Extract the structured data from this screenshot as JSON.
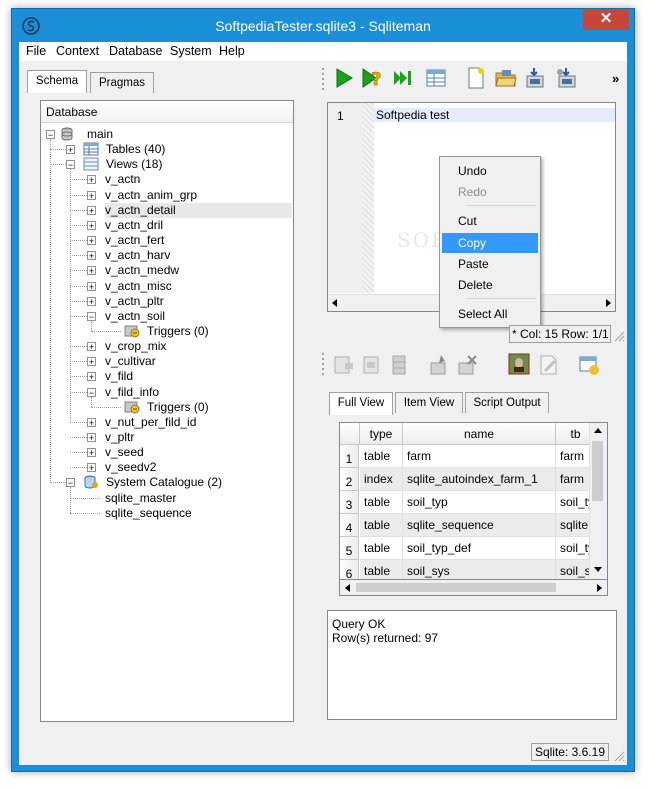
{
  "window": {
    "title": "SoftpediaTester.sqlite3 - Sqliteman",
    "close_glyph": "✕",
    "watermark": "SOFTPEDIA"
  },
  "menubar": {
    "items": [
      "File",
      "Context",
      "Database",
      "System",
      "Help"
    ]
  },
  "left_tabs": [
    "Schema",
    "Pragmas"
  ],
  "tree": {
    "header": "Database",
    "main_label": "main",
    "tables_label": "Tables (40)",
    "views_label": "Views (18)",
    "views": [
      "v_actn",
      "v_actn_anim_grp",
      "v_actn_detail",
      "v_actn_dril",
      "v_actn_fert",
      "v_actn_harv",
      "v_actn_medw",
      "v_actn_misc",
      "v_actn_pltr",
      "v_actn_soil",
      "v_crop_mix",
      "v_cultivar",
      "v_fild",
      "v_fild_info",
      "v_nut_per_fild_id",
      "v_pltr",
      "v_seed",
      "v_seedv2"
    ],
    "triggers_label": "Triggers (0)",
    "system_catalogue_label": "System Catalogue (2)",
    "system_items": [
      "sqlite_master",
      "sqlite_sequence"
    ]
  },
  "toolbar": {
    "overflow_glyph": "»"
  },
  "editor": {
    "line_number": "1",
    "text": "Softpedia test"
  },
  "context_menu": {
    "items": [
      {
        "label": "Undo",
        "enabled": true
      },
      {
        "label": "Redo",
        "enabled": false
      },
      {
        "label": "Cut",
        "enabled": true
      },
      {
        "label": "Copy",
        "enabled": true,
        "highlighted": true
      },
      {
        "label": "Paste",
        "enabled": true
      },
      {
        "label": "Delete",
        "enabled": true
      },
      {
        "label": "Select All",
        "enabled": true
      }
    ]
  },
  "editor_status": "* Col: 15 Row: 1/1",
  "result_tabs": [
    "Full View",
    "Item View",
    "Script Output"
  ],
  "grid": {
    "columns": [
      "type",
      "name",
      "tb"
    ],
    "rows": [
      [
        "1",
        "table",
        "farm",
        "farm"
      ],
      [
        "2",
        "index",
        "sqlite_autoindex_farm_1",
        "farm"
      ],
      [
        "3",
        "table",
        "soil_typ",
        "soil_ty"
      ],
      [
        "4",
        "table",
        "sqlite_sequence",
        "sqlite"
      ],
      [
        "5",
        "table",
        "soil_typ_def",
        "soil_ty"
      ],
      [
        "6",
        "table",
        "soil_sys",
        "soil_sy"
      ]
    ]
  },
  "output": {
    "line1": "Query OK",
    "line2": "Row(s) returned: 97"
  },
  "status": {
    "version": "Sqlite: 3.6.19"
  },
  "colors": {
    "titlebar": "#1a8fd8",
    "close": "#c7463a",
    "highlight": "#3399ff"
  }
}
